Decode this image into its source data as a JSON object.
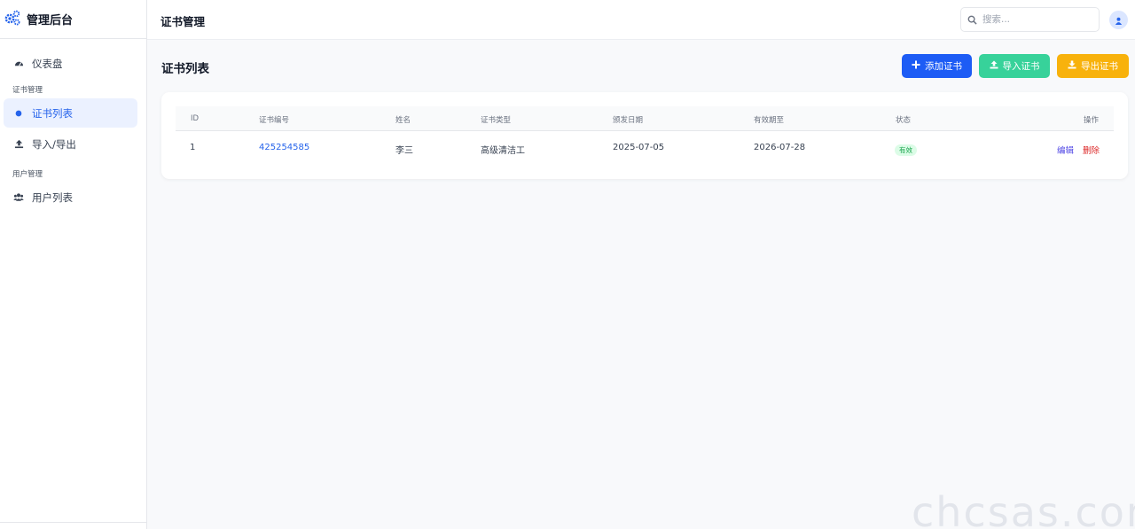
{
  "app": {
    "title": "管理后台"
  },
  "sidebar": {
    "items": [
      {
        "label": "仪表盘",
        "icon": "dashboard-icon"
      },
      {
        "label": "证书列表",
        "icon": "dot-icon",
        "active": true
      },
      {
        "label": "导入/导出",
        "icon": "upload-icon"
      },
      {
        "label": "用户列表",
        "icon": "users-icon"
      }
    ],
    "sections": [
      {
        "label": "证书管理"
      },
      {
        "label": "用户管理"
      }
    ]
  },
  "header": {
    "title": "证书管理",
    "search": {
      "placeholder": "搜索...",
      "value": ""
    }
  },
  "main": {
    "title": "证书列表",
    "buttons": {
      "add": "添加证书",
      "import": "导入证书",
      "export": "导出证书"
    },
    "table": {
      "columns": [
        "ID",
        "证书编号",
        "姓名",
        "证书类型",
        "颁发日期",
        "有效期至",
        "状态",
        "操作"
      ],
      "rows": [
        {
          "id": "1",
          "cert_no": "425254585",
          "name": "李三",
          "type": "高级清洁工",
          "issue_date": "2025-07-05",
          "expiry": "2026-07-28",
          "status": "有效",
          "edit": "编辑",
          "delete": "删除"
        }
      ]
    }
  },
  "watermark": "chcsas.com",
  "colors": {
    "primary": "#1d5cf5",
    "success": "#37d29a",
    "warning": "#f8b20c",
    "danger": "#dc2626",
    "link": "#2563eb"
  }
}
